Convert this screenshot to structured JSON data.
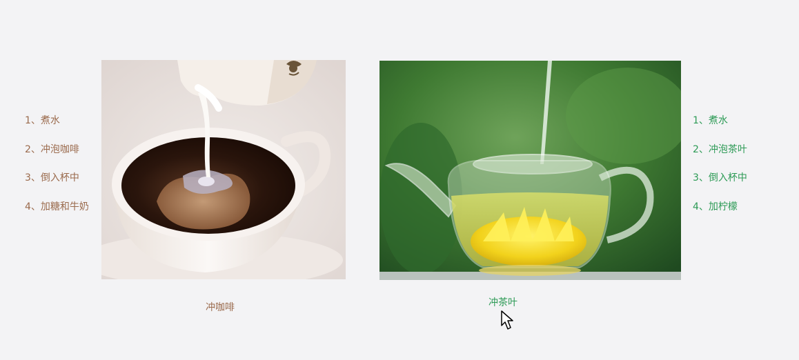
{
  "coffee": {
    "steps": [
      "1、煮水",
      "2、冲泡咖啡",
      "3、倒入杯中",
      "4、加糖和牛奶"
    ],
    "caption": "冲咖啡",
    "color": "#9a6a4c"
  },
  "tea": {
    "steps": [
      "1、煮水",
      "2、冲泡茶叶",
      "3、倒入杯中",
      "4、加柠檬"
    ],
    "caption": "冲茶叶",
    "color": "#2c9a55"
  }
}
